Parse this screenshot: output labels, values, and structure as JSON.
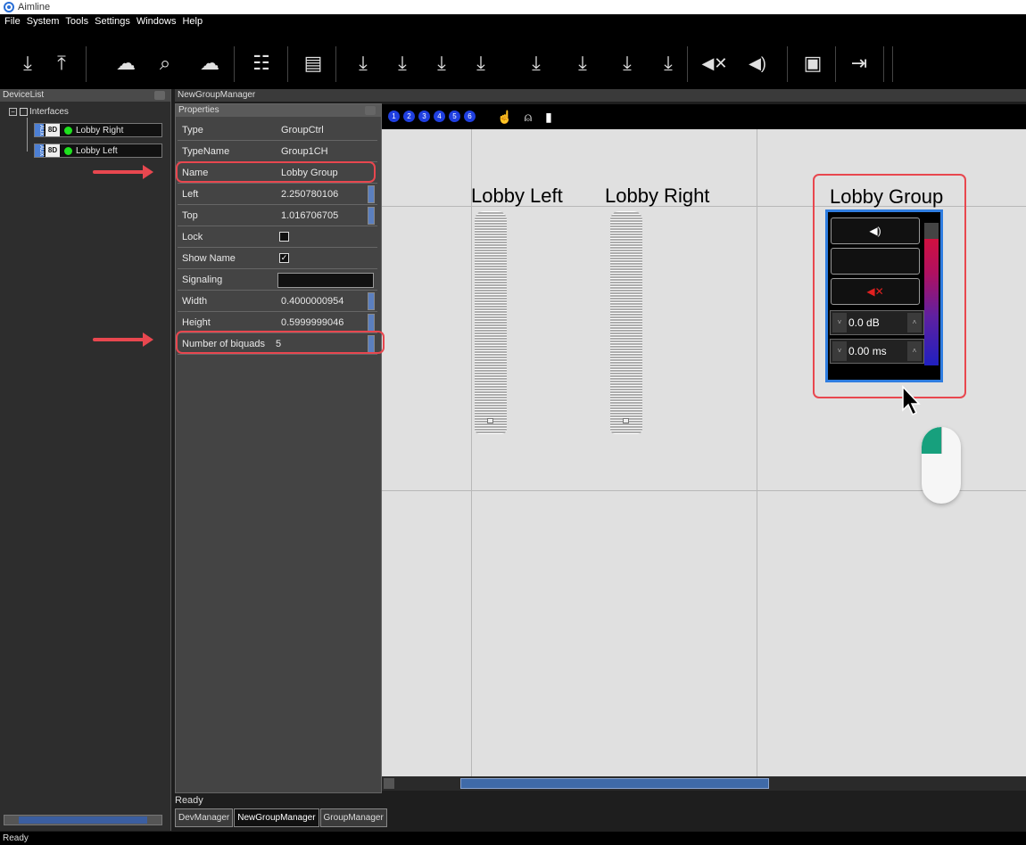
{
  "app": {
    "title": "Aimline"
  },
  "menu": [
    "File",
    "System",
    "Tools",
    "Settings",
    "Windows",
    "Help"
  ],
  "toolbar": {
    "icons": [
      "download-icon",
      "upload-icon",
      "cloud-download-icon",
      "search-icon",
      "cloud-upload-icon",
      "sliders-icon",
      "layout-icon",
      "download-icon",
      "download-icon",
      "download-icon",
      "download-icon",
      "download-icon",
      "download-icon",
      "download-icon",
      "download-icon",
      "mute-icon",
      "volume-icon",
      "save-icon",
      "exit-icon"
    ]
  },
  "device_list": {
    "title": "DeviceList",
    "root_label": "Interfaces",
    "items": [
      {
        "aux": "AUX",
        "badge": "8D",
        "label": "Lobby Right",
        "status_color": "#1ee21e"
      },
      {
        "aux": "AUX",
        "badge": "8D",
        "label": "Lobby Left",
        "status_color": "#1ee21e"
      }
    ]
  },
  "group_manager": {
    "title": "NewGroupManager"
  },
  "properties": {
    "title": "Properties",
    "rows": [
      {
        "key": "Type",
        "value": "GroupCtrl"
      },
      {
        "key": "TypeName",
        "value": "Group1CH"
      },
      {
        "key": "Name",
        "value": "Lobby Group"
      },
      {
        "key": "Left",
        "value": "2.250780106"
      },
      {
        "key": "Top",
        "value": "1.016706705"
      },
      {
        "key": "Lock",
        "value": ""
      },
      {
        "key": "Show Name",
        "value": ""
      },
      {
        "key": "Signaling",
        "value": ""
      },
      {
        "key": "Width",
        "value": "0.4000000954"
      },
      {
        "key": "Height",
        "value": "0.5999999046"
      },
      {
        "key": "Number of biquads",
        "value": "5"
      }
    ],
    "lock_checked": false,
    "show_name_checked": true
  },
  "canvas": {
    "preset_buttons": [
      "1",
      "2",
      "3",
      "4",
      "5",
      "6"
    ],
    "labels": {
      "left": "Lobby Left",
      "right": "Lobby Right",
      "group": "Lobby Group"
    },
    "group_ctrl": {
      "gain": "0.0 dB",
      "delay": "0.00 ms"
    }
  },
  "inner_status": "Ready",
  "tabs": [
    "DevManager",
    "NewGroupManager",
    "GroupManager"
  ],
  "active_tab": "NewGroupManager",
  "status": "Ready",
  "colors": {
    "highlight": "#e8474f",
    "selection": "#2f7de0",
    "online": "#1ee21e"
  }
}
